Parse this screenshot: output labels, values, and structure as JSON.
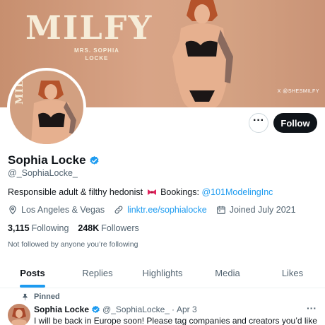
{
  "banner": {
    "brand": "MILFY",
    "subtitle": "MRS. SOPHIA LOCKE",
    "watermark": "X @SHESMILFY"
  },
  "avatar": {
    "brand": "MILFY"
  },
  "actions": {
    "more_icon": "more-icon",
    "follow_label": "Follow"
  },
  "profile": {
    "name": "Sophia Locke",
    "handle": "@_SophiaLocke_",
    "bio_text": "Responsible adult & filthy hedonist",
    "bio_bookings": "Bookings:",
    "bio_mention": "@101ModelingInc",
    "location": "Los Angeles & Vegas",
    "link": "linktr.ee/sophialocke",
    "joined": "Joined July 2021",
    "following_count": "3,115",
    "following_label": "Following",
    "followers_count": "248K",
    "followers_label": "Followers",
    "not_followed": "Not followed by anyone you’re following"
  },
  "tabs": [
    {
      "label": "Posts",
      "active": true
    },
    {
      "label": "Replies"
    },
    {
      "label": "Highlights"
    },
    {
      "label": "Media"
    },
    {
      "label": "Likes"
    }
  ],
  "pinned_post": {
    "pinned_label": "Pinned",
    "author": "Sophia Locke",
    "handle": "@_SophiaLocke_",
    "separator": "·",
    "date": "Apr 3",
    "more": "···",
    "text": "I will be back in Europe soon! Please tag companies and creators you’d like"
  },
  "colors": {
    "accent": "#1d9bf0",
    "text": "#0f1419",
    "muted": "#536471"
  }
}
